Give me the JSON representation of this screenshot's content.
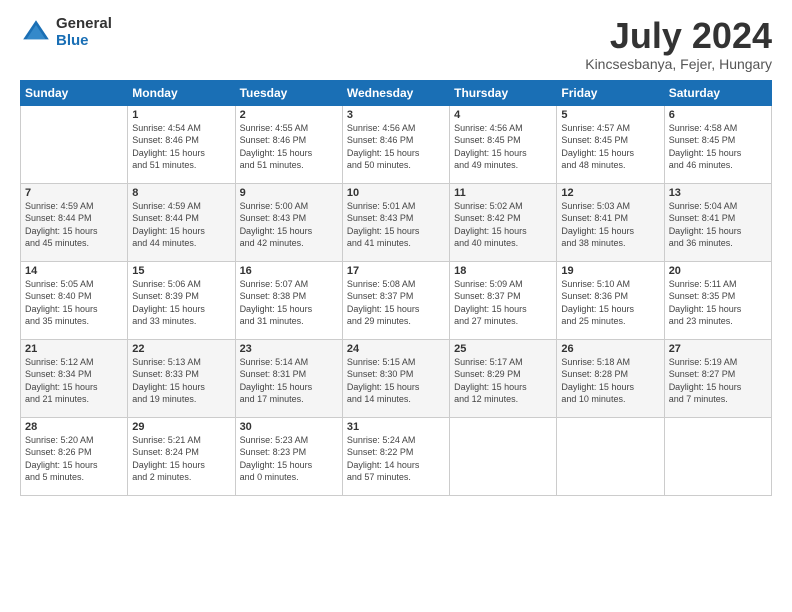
{
  "logo": {
    "general": "General",
    "blue": "Blue"
  },
  "title": "July 2024",
  "subtitle": "Kincsesbanya, Fejer, Hungary",
  "headers": [
    "Sunday",
    "Monday",
    "Tuesday",
    "Wednesday",
    "Thursday",
    "Friday",
    "Saturday"
  ],
  "weeks": [
    [
      {
        "day": "",
        "info": ""
      },
      {
        "day": "1",
        "info": "Sunrise: 4:54 AM\nSunset: 8:46 PM\nDaylight: 15 hours\nand 51 minutes."
      },
      {
        "day": "2",
        "info": "Sunrise: 4:55 AM\nSunset: 8:46 PM\nDaylight: 15 hours\nand 51 minutes."
      },
      {
        "day": "3",
        "info": "Sunrise: 4:56 AM\nSunset: 8:46 PM\nDaylight: 15 hours\nand 50 minutes."
      },
      {
        "day": "4",
        "info": "Sunrise: 4:56 AM\nSunset: 8:45 PM\nDaylight: 15 hours\nand 49 minutes."
      },
      {
        "day": "5",
        "info": "Sunrise: 4:57 AM\nSunset: 8:45 PM\nDaylight: 15 hours\nand 48 minutes."
      },
      {
        "day": "6",
        "info": "Sunrise: 4:58 AM\nSunset: 8:45 PM\nDaylight: 15 hours\nand 46 minutes."
      }
    ],
    [
      {
        "day": "7",
        "info": "Sunrise: 4:59 AM\nSunset: 8:44 PM\nDaylight: 15 hours\nand 45 minutes."
      },
      {
        "day": "8",
        "info": "Sunrise: 4:59 AM\nSunset: 8:44 PM\nDaylight: 15 hours\nand 44 minutes."
      },
      {
        "day": "9",
        "info": "Sunrise: 5:00 AM\nSunset: 8:43 PM\nDaylight: 15 hours\nand 42 minutes."
      },
      {
        "day": "10",
        "info": "Sunrise: 5:01 AM\nSunset: 8:43 PM\nDaylight: 15 hours\nand 41 minutes."
      },
      {
        "day": "11",
        "info": "Sunrise: 5:02 AM\nSunset: 8:42 PM\nDaylight: 15 hours\nand 40 minutes."
      },
      {
        "day": "12",
        "info": "Sunrise: 5:03 AM\nSunset: 8:41 PM\nDaylight: 15 hours\nand 38 minutes."
      },
      {
        "day": "13",
        "info": "Sunrise: 5:04 AM\nSunset: 8:41 PM\nDaylight: 15 hours\nand 36 minutes."
      }
    ],
    [
      {
        "day": "14",
        "info": "Sunrise: 5:05 AM\nSunset: 8:40 PM\nDaylight: 15 hours\nand 35 minutes."
      },
      {
        "day": "15",
        "info": "Sunrise: 5:06 AM\nSunset: 8:39 PM\nDaylight: 15 hours\nand 33 minutes."
      },
      {
        "day": "16",
        "info": "Sunrise: 5:07 AM\nSunset: 8:38 PM\nDaylight: 15 hours\nand 31 minutes."
      },
      {
        "day": "17",
        "info": "Sunrise: 5:08 AM\nSunset: 8:37 PM\nDaylight: 15 hours\nand 29 minutes."
      },
      {
        "day": "18",
        "info": "Sunrise: 5:09 AM\nSunset: 8:37 PM\nDaylight: 15 hours\nand 27 minutes."
      },
      {
        "day": "19",
        "info": "Sunrise: 5:10 AM\nSunset: 8:36 PM\nDaylight: 15 hours\nand 25 minutes."
      },
      {
        "day": "20",
        "info": "Sunrise: 5:11 AM\nSunset: 8:35 PM\nDaylight: 15 hours\nand 23 minutes."
      }
    ],
    [
      {
        "day": "21",
        "info": "Sunrise: 5:12 AM\nSunset: 8:34 PM\nDaylight: 15 hours\nand 21 minutes."
      },
      {
        "day": "22",
        "info": "Sunrise: 5:13 AM\nSunset: 8:33 PM\nDaylight: 15 hours\nand 19 minutes."
      },
      {
        "day": "23",
        "info": "Sunrise: 5:14 AM\nSunset: 8:31 PM\nDaylight: 15 hours\nand 17 minutes."
      },
      {
        "day": "24",
        "info": "Sunrise: 5:15 AM\nSunset: 8:30 PM\nDaylight: 15 hours\nand 14 minutes."
      },
      {
        "day": "25",
        "info": "Sunrise: 5:17 AM\nSunset: 8:29 PM\nDaylight: 15 hours\nand 12 minutes."
      },
      {
        "day": "26",
        "info": "Sunrise: 5:18 AM\nSunset: 8:28 PM\nDaylight: 15 hours\nand 10 minutes."
      },
      {
        "day": "27",
        "info": "Sunrise: 5:19 AM\nSunset: 8:27 PM\nDaylight: 15 hours\nand 7 minutes."
      }
    ],
    [
      {
        "day": "28",
        "info": "Sunrise: 5:20 AM\nSunset: 8:26 PM\nDaylight: 15 hours\nand 5 minutes."
      },
      {
        "day": "29",
        "info": "Sunrise: 5:21 AM\nSunset: 8:24 PM\nDaylight: 15 hours\nand 2 minutes."
      },
      {
        "day": "30",
        "info": "Sunrise: 5:23 AM\nSunset: 8:23 PM\nDaylight: 15 hours\nand 0 minutes."
      },
      {
        "day": "31",
        "info": "Sunrise: 5:24 AM\nSunset: 8:22 PM\nDaylight: 14 hours\nand 57 minutes."
      },
      {
        "day": "",
        "info": ""
      },
      {
        "day": "",
        "info": ""
      },
      {
        "day": "",
        "info": ""
      }
    ]
  ]
}
